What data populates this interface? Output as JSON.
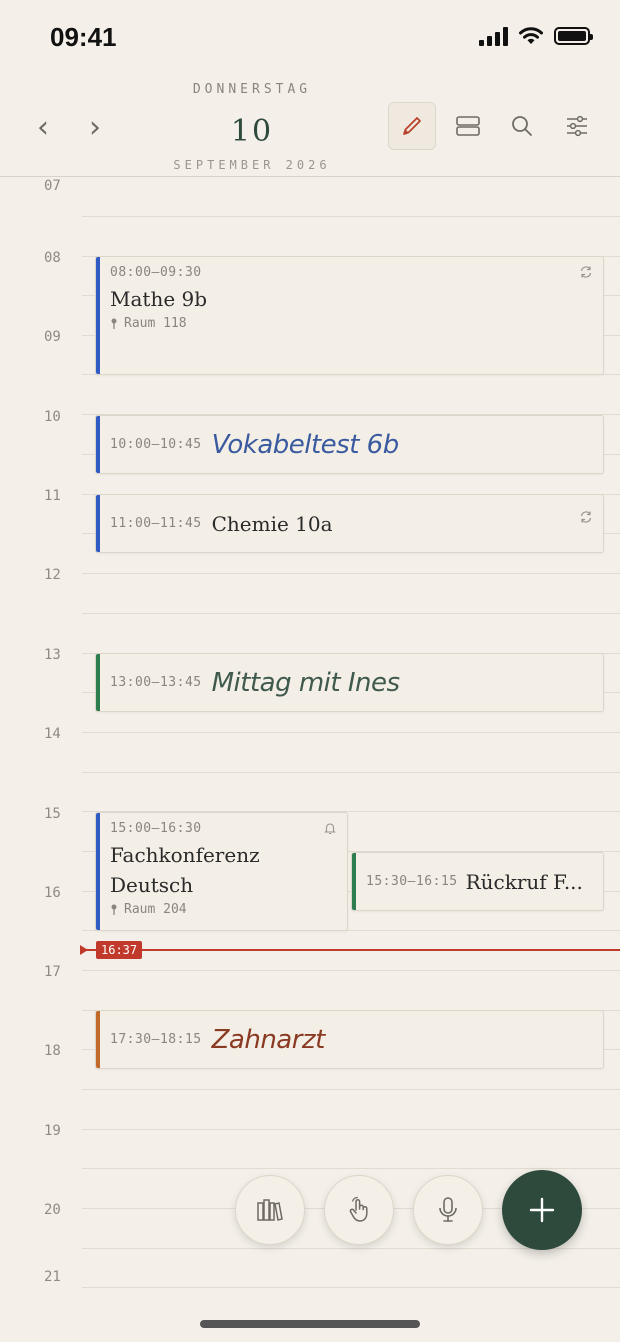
{
  "status_bar": {
    "time": "09:41"
  },
  "header": {
    "weekday": "DONNERSTAG",
    "day": "10",
    "month_year": "SEPTEMBER 2026",
    "prev_icon": "chevron-left-icon",
    "next_icon": "chevron-right-icon",
    "tools": [
      "pen-icon",
      "split-view-icon",
      "search-icon",
      "filter-sliders-icon"
    ]
  },
  "timeline": {
    "hours": [
      "07",
      "08",
      "09",
      "10",
      "11",
      "12",
      "13",
      "14",
      "15",
      "16",
      "17",
      "18",
      "19",
      "20",
      "21"
    ],
    "now_label": "16:37"
  },
  "events": [
    {
      "time": "08:00–09:30",
      "title": "Mathe 9b",
      "location": "Raum 118",
      "color": "#2f5bc4",
      "icon": "repeat-icon"
    },
    {
      "time": "10:00–10:45",
      "title": "Vokabeltest 6b",
      "color": "#2f5bc4",
      "ink": "#3a5aa0"
    },
    {
      "time": "11:00–11:45",
      "title": "Chemie 10a",
      "color": "#2f5bc4",
      "icon": "repeat-icon"
    },
    {
      "time": "13:00–13:45",
      "title": "Mittag mit Ines",
      "color": "#2e7d4f",
      "ink": "#3f5a4d"
    },
    {
      "time": "15:00–16:30",
      "title": "Fachkonferenz Deutsch",
      "location": "Raum 204",
      "color": "#2f5bc4",
      "icon": "bell-icon"
    },
    {
      "time": "15:30–16:15",
      "title": "Rückruf F...",
      "color": "#2e7d4f"
    },
    {
      "time": "17:30–18:15",
      "title": "Zahnarzt",
      "color": "#c0692b",
      "ink": "#8a3a22"
    }
  ],
  "actions": [
    "books-icon",
    "hand-touch-icon",
    "microphone-icon",
    "plus-icon"
  ],
  "colors": {
    "accent": "#2e4a3c",
    "now": "#c0392b",
    "background": "#f4f0e9"
  }
}
